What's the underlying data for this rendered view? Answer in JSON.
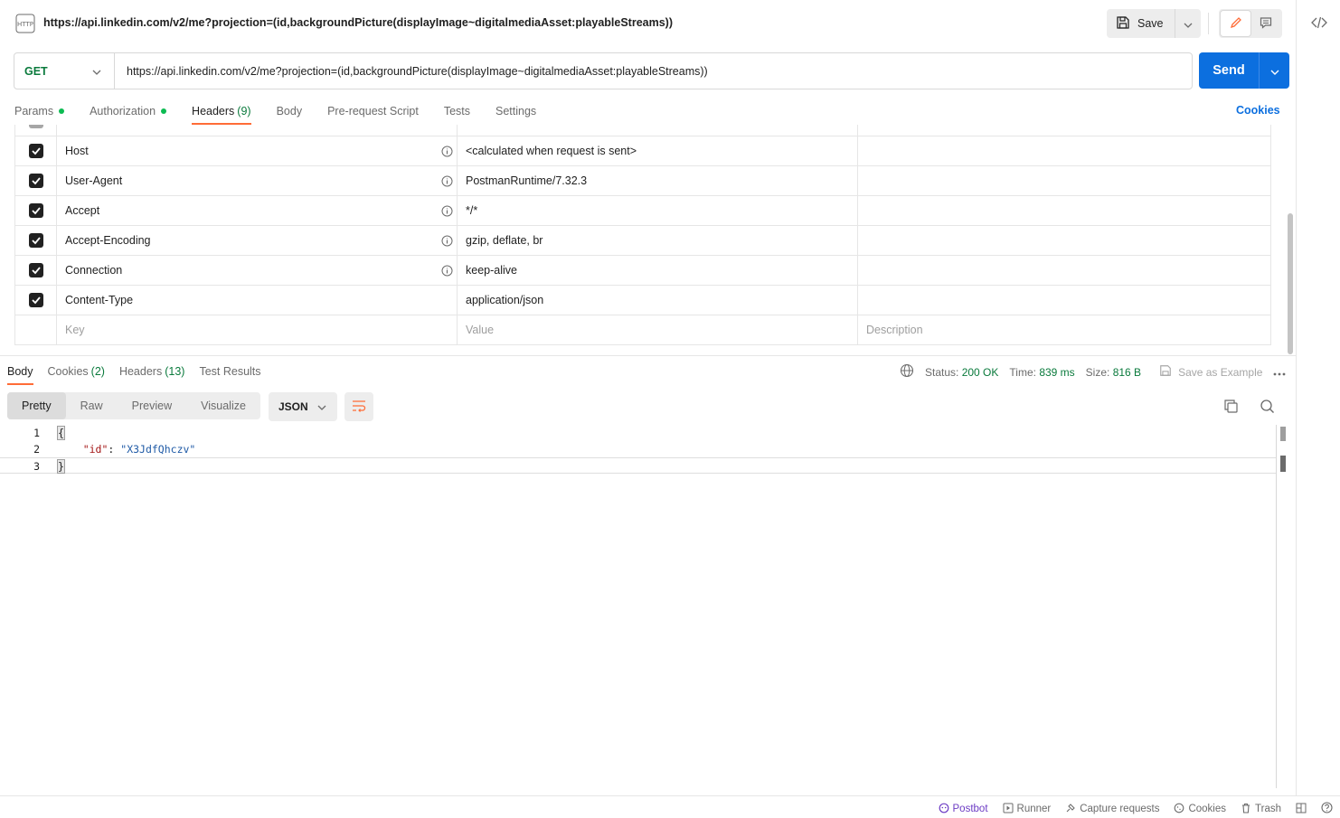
{
  "title": {
    "url": "https://api.linkedin.com/v2/me?projection=(id,backgroundPicture(displayImage~digitalmediaAsset:playableStreams))",
    "save_label": "Save"
  },
  "request": {
    "method": "GET",
    "url": "https://api.linkedin.com/v2/me?projection=(id,backgroundPicture(displayImage~digitalmediaAsset:playableStreams))",
    "send_label": "Send"
  },
  "tabs": {
    "params": "Params",
    "authorization": "Authorization",
    "headers": "Headers",
    "headers_count": "(9)",
    "body": "Body",
    "pre_request": "Pre-request Script",
    "tests": "Tests",
    "settings": "Settings",
    "cookies": "Cookies"
  },
  "headers": {
    "rows": [
      {
        "key": "Host",
        "value": "<calculated when request is sent>"
      },
      {
        "key": "User-Agent",
        "value": "PostmanRuntime/7.32.3"
      },
      {
        "key": "Accept",
        "value": "*/*"
      },
      {
        "key": "Accept-Encoding",
        "value": "gzip, deflate, br"
      },
      {
        "key": "Connection",
        "value": "keep-alive"
      },
      {
        "key": "Content-Type",
        "value": "application/json"
      }
    ],
    "placeholder_key": "Key",
    "placeholder_value": "Value",
    "placeholder_description": "Description"
  },
  "response": {
    "tabs": {
      "body": "Body",
      "cookies": "Cookies",
      "cookies_count": "(2)",
      "headers": "Headers",
      "headers_count": "(13)",
      "test_results": "Test Results"
    },
    "status_label": "Status:",
    "status_value": "200 OK",
    "time_label": "Time:",
    "time_value": "839 ms",
    "size_label": "Size:",
    "size_value": "816 B",
    "save_example": "Save as Example",
    "views": [
      "Pretty",
      "Raw",
      "Preview",
      "Visualize"
    ],
    "format": "JSON",
    "code": {
      "line1": "{",
      "line2_key": "\"id\"",
      "line2_sep": ": ",
      "line2_val": "\"X3JdfQhczv\"",
      "line3": "}"
    },
    "line_numbers": [
      "1",
      "2",
      "3"
    ]
  },
  "statusbar": {
    "postbot": "Postbot",
    "runner": "Runner",
    "capture": "Capture requests",
    "cookies": "Cookies",
    "trash": "Trash"
  },
  "colors": {
    "accent": "#ff6c37",
    "primary": "#0c6fdf",
    "success": "#0a7a3c"
  }
}
